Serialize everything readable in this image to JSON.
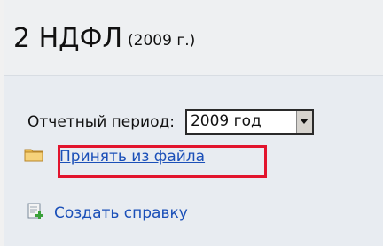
{
  "header": {
    "title": "2 НДФЛ",
    "year": "(2009 г.)"
  },
  "period": {
    "label": "Отчетный период:",
    "selected_value": "2009 год"
  },
  "actions": {
    "import_from_file": "Принять из файла",
    "create_certificate": "Создать справку"
  },
  "colors": {
    "link": "#1a4fb8",
    "highlight_border": "#e2142d",
    "folder_icon": "#e8b84a",
    "doc_plus_icon": "#3aa03a"
  },
  "icons": {
    "import": "folder-icon",
    "create": "document-plus-icon",
    "dropdown": "chevron-down-icon"
  }
}
